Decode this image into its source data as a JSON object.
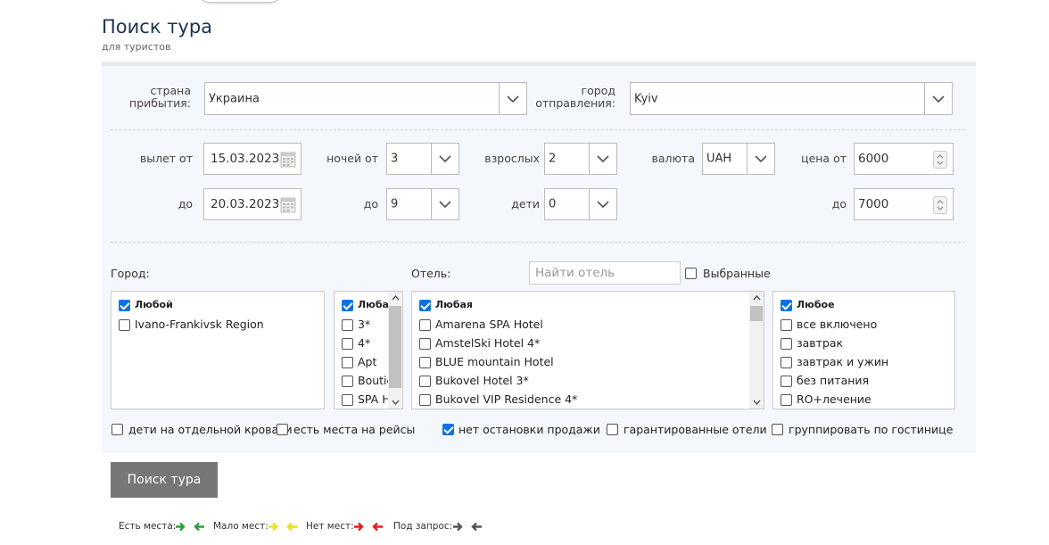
{
  "page": {
    "title": "Поиск тура",
    "subtitle": "для туристов"
  },
  "form": {
    "country_label_1": "страна",
    "country_label_2": "прибытия:",
    "country_value": "Украина",
    "city_label_1": "город",
    "city_label_2": "отправления:",
    "city_value": "Kyiv",
    "departure_from_label": "вылет от",
    "departure_from": "15.03.2023",
    "departure_to_label": "до",
    "departure_to": "20.03.2023",
    "nights_from_label": "ночей от",
    "nights_from": "3",
    "nights_to_label": "до",
    "nights_to": "9",
    "adults_label": "взрослых",
    "adults": "2",
    "children_label": "дети",
    "children": "0",
    "currency_label": "валюта",
    "currency": "UAH",
    "price_from_label": "цена от",
    "price_from": "6000",
    "price_to_label": "до",
    "price_to": "7000"
  },
  "filters": {
    "city_label": "Город:",
    "hotel_label": "Отель:",
    "hotel_search_placeholder": "Найти отель",
    "selected_label": "Выбранные",
    "cities": [
      {
        "label": "Любой",
        "checked": true
      },
      {
        "label": "Ivano-Frankivsk Region",
        "checked": false
      }
    ],
    "categories": [
      {
        "label": "Любая",
        "checked": true
      },
      {
        "label": "3*",
        "checked": false
      },
      {
        "label": "4*",
        "checked": false
      },
      {
        "label": "Apt",
        "checked": false
      },
      {
        "label": "Boutic",
        "checked": false
      },
      {
        "label": "SPA H",
        "checked": false
      }
    ],
    "hotels": [
      {
        "label": "Любая",
        "checked": true
      },
      {
        "label": "Amarena SPA Hotel",
        "checked": false
      },
      {
        "label": "AmstelSki Hotel 4*",
        "checked": false
      },
      {
        "label": "BLUE mountain Hotel",
        "checked": false
      },
      {
        "label": "Bukovel Hotel 3*",
        "checked": false
      },
      {
        "label": "Bukovel VIP Residence 4*",
        "checked": false
      }
    ],
    "meals": [
      {
        "label": "Любое",
        "checked": true
      },
      {
        "label": "все включено",
        "checked": false
      },
      {
        "label": "завтрак",
        "checked": false
      },
      {
        "label": "завтрак и ужин",
        "checked": false
      },
      {
        "label": "без питания",
        "checked": false
      },
      {
        "label": "RO+лечение",
        "checked": false
      }
    ]
  },
  "options": [
    {
      "label": "дети на отдельной кровати",
      "checked": false
    },
    {
      "label": "есть места на рейсы",
      "checked": false
    },
    {
      "label": "нет остановки продажи",
      "checked": true
    },
    {
      "label": "гарантированные отели",
      "checked": false
    },
    {
      "label": "группировать по гостинице",
      "checked": false
    }
  ],
  "search_button": "Поиск тура",
  "legend": {
    "available": "Есть места:",
    "few": "Мало мест:",
    "none": "Нет мест:",
    "on_request": "Под запрос:",
    "colors": {
      "available": "#2e9e3a",
      "few": "#e8e01a",
      "none": "#e02020",
      "on_request": "#555555"
    }
  }
}
